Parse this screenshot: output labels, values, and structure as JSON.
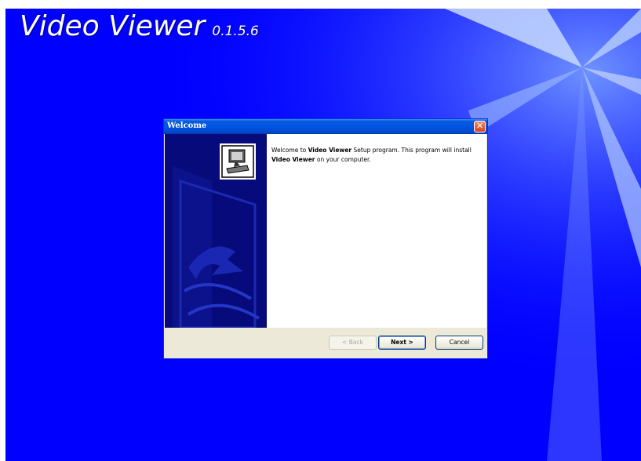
{
  "screen": {
    "background_color": "#0000ff",
    "app_title": "Video Viewer",
    "app_version": "0.1.5.6"
  },
  "dialog": {
    "title": "Welcome",
    "close_label": "✕",
    "welcome_prefix": "Welcome to ",
    "welcome_app": "Video Viewer",
    "welcome_middle": " Setup program. This program will install ",
    "welcome_app2": "Video Viewer",
    "welcome_suffix": " on your computer.",
    "icon": "installer-computer-icon",
    "buttons": {
      "back": "< Back",
      "next": "Next >",
      "cancel": "Cancel"
    },
    "titlebar_color": "#0054e3",
    "side_panel_color": "#060a7a"
  }
}
